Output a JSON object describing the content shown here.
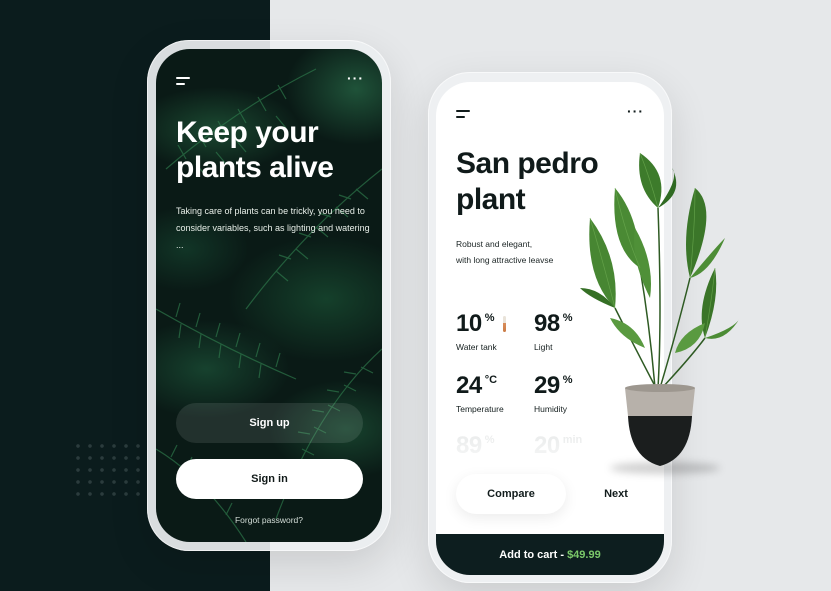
{
  "left_screen": {
    "title": "Keep your plants alive",
    "description": "Taking care of plants can be trickly, you need to consider variables, such as lighting and watering ...",
    "signup_label": "Sign up",
    "signin_label": "Sign in",
    "forgot_label": "Forgot password?"
  },
  "right_screen": {
    "title": "San pedro plant",
    "description_line1": "Robust and elegant,",
    "description_line2": "with long attractive leavse",
    "stats": [
      {
        "value": "10",
        "unit": "%",
        "label": "Water tank"
      },
      {
        "value": "98",
        "unit": "%",
        "label": "Light"
      },
      {
        "value": "24",
        "unit": "°C",
        "label": "Temperature"
      },
      {
        "value": "29",
        "unit": "%",
        "label": "Humidity"
      },
      {
        "value": "89",
        "unit": "%",
        "label": ""
      },
      {
        "value": "20",
        "unit": "min",
        "label": ""
      }
    ],
    "compare_label": "Compare",
    "next_label": "Next",
    "cart_label": "Add to cart -",
    "cart_price": "$49.99"
  },
  "icons": {
    "menu": "menu-icon",
    "more": "more-dots-icon",
    "thermometer": "thermometer-icon"
  },
  "colors": {
    "dark_bg": "#0b1c1d",
    "accent_price": "#7bc96a",
    "light_bg": "#e6e8ea"
  }
}
